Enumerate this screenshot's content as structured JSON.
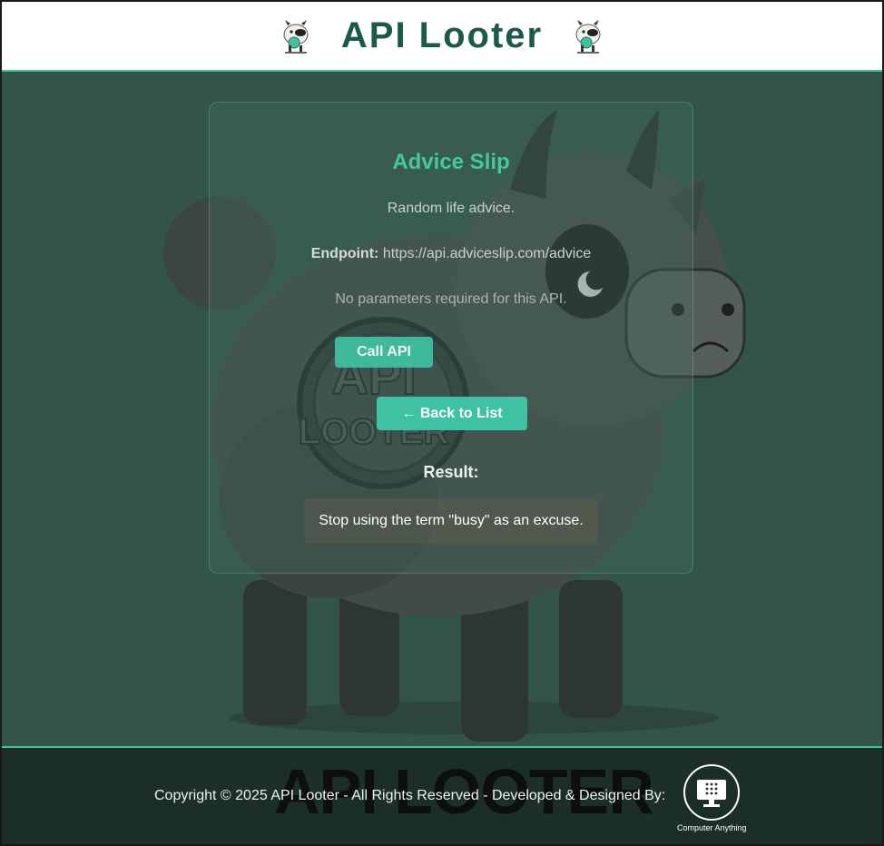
{
  "header": {
    "title": "API Looter",
    "logo_icon": "cow-mascot-icon"
  },
  "card": {
    "title": "Advice Slip",
    "description": "Random life advice.",
    "endpoint_label": "Endpoint:",
    "endpoint_url": "https://api.adviceslip.com/advice",
    "params_note": "No parameters required for this API.",
    "call_button": "Call API",
    "back_button": "← Back to List",
    "result_label": "Result:",
    "result_text": "Stop using the term \"busy\" as an excuse."
  },
  "footer": {
    "watermark": "API LOOTER",
    "copyright": "Copyright © 2025 API Looter - All Rights Reserved - Developed & Designed By:",
    "brand_caption": "Computer Anything"
  },
  "colors": {
    "accent": "#3fc2a2",
    "title_green": "#1b5a4a",
    "background": "#33544a",
    "footer_bg": "#1c2e28"
  }
}
